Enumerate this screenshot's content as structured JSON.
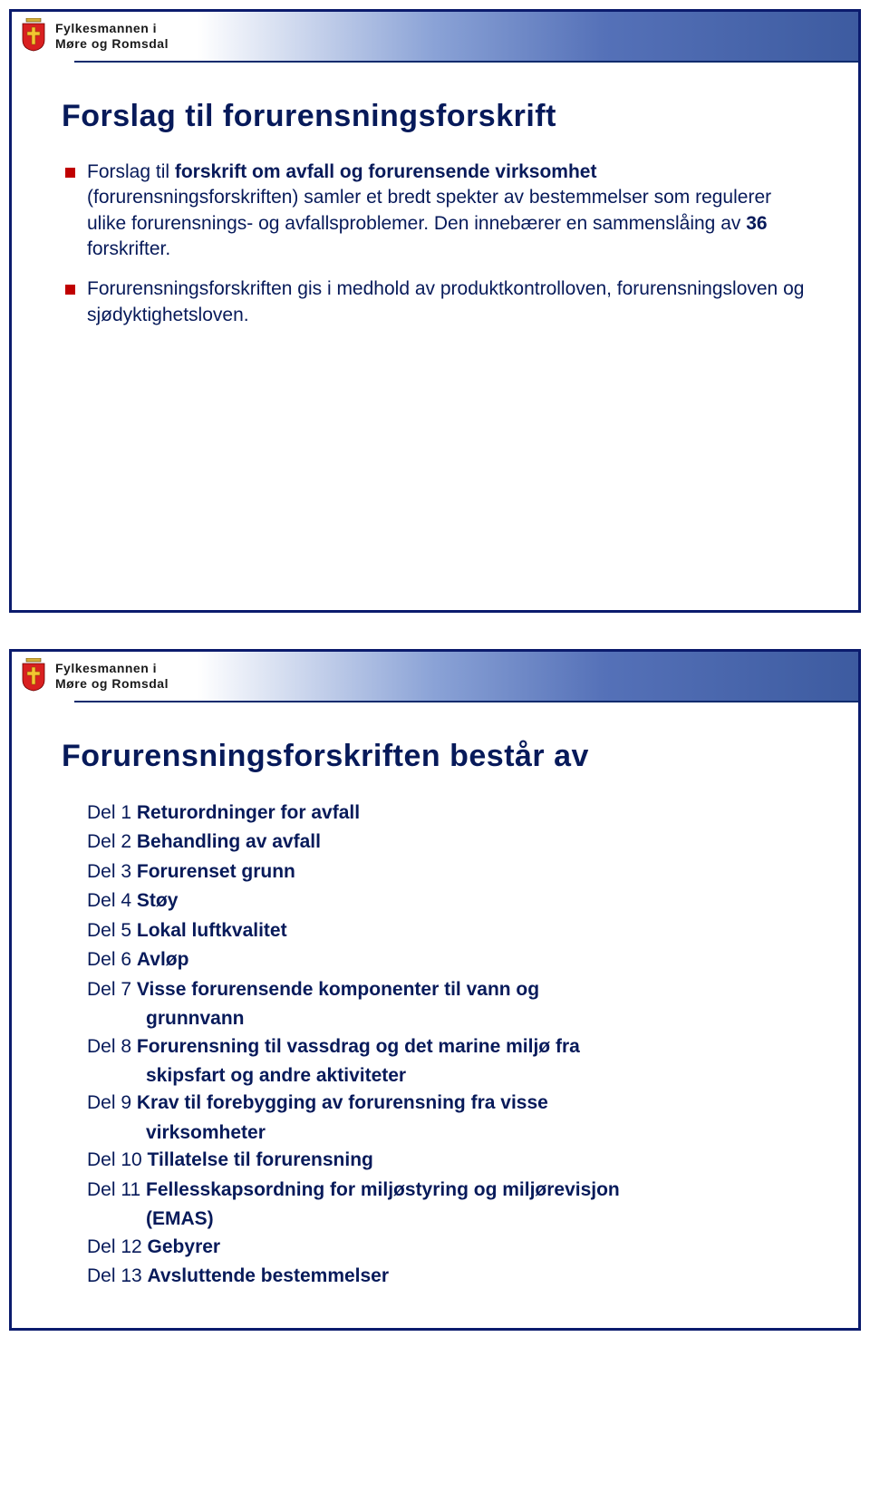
{
  "org": {
    "line1": "Fylkesmannen i",
    "line2": "Møre og Romsdal"
  },
  "slide1": {
    "title": "Forslag til forurensningsforskrift",
    "bullets": [
      {
        "prefix": "Forslag til ",
        "bold": "forskrift om avfall og forurensende virksomhet",
        "rest": " (forurensningsforskriften) samler et bredt spekter av bestemmelser som regulerer ulike forurensnings- og avfallsproblemer. Den innebærer en sammenslåing av ",
        "count": "36",
        "tail": " forskrifter."
      },
      {
        "text": "Forurensningsforskriften gis i medhold av produktkontrolloven, forurensningsloven og sjødyktighetsloven."
      }
    ]
  },
  "slide2": {
    "title": "Forurensningsforskriften består av",
    "parts": [
      {
        "num": "Del 1",
        "name": "Returordninger for avfall"
      },
      {
        "num": "Del 2",
        "name": "Behandling av avfall"
      },
      {
        "num": "Del 3",
        "name": "Forurenset grunn"
      },
      {
        "num": "Del 4",
        "name": "Støy"
      },
      {
        "num": "Del 5",
        "name": "Lokal luftkvalitet"
      },
      {
        "num": "Del 6",
        "name": "Avløp"
      },
      {
        "num": "Del 7",
        "name": "Visse forurensende komponenter til vann og",
        "sub": "grunnvann"
      },
      {
        "num": "Del 8",
        "name": "Forurensning til vassdrag og det marine miljø fra",
        "sub": "skipsfart og andre aktiviteter"
      },
      {
        "num": "Del 9",
        "name": "Krav til forebygging av forurensning fra visse",
        "sub": "virksomheter"
      },
      {
        "num": "Del 10",
        "name": "Tillatelse til forurensning"
      },
      {
        "num": "Del 11",
        "name": "Fellesskapsordning for miljøstyring og miljørevisjon",
        "sub": "(EMAS)"
      },
      {
        "num": "Del 12",
        "name": "Gebyrer"
      },
      {
        "num": "Del 13",
        "name": "Avsluttende bestemmelser"
      }
    ]
  }
}
